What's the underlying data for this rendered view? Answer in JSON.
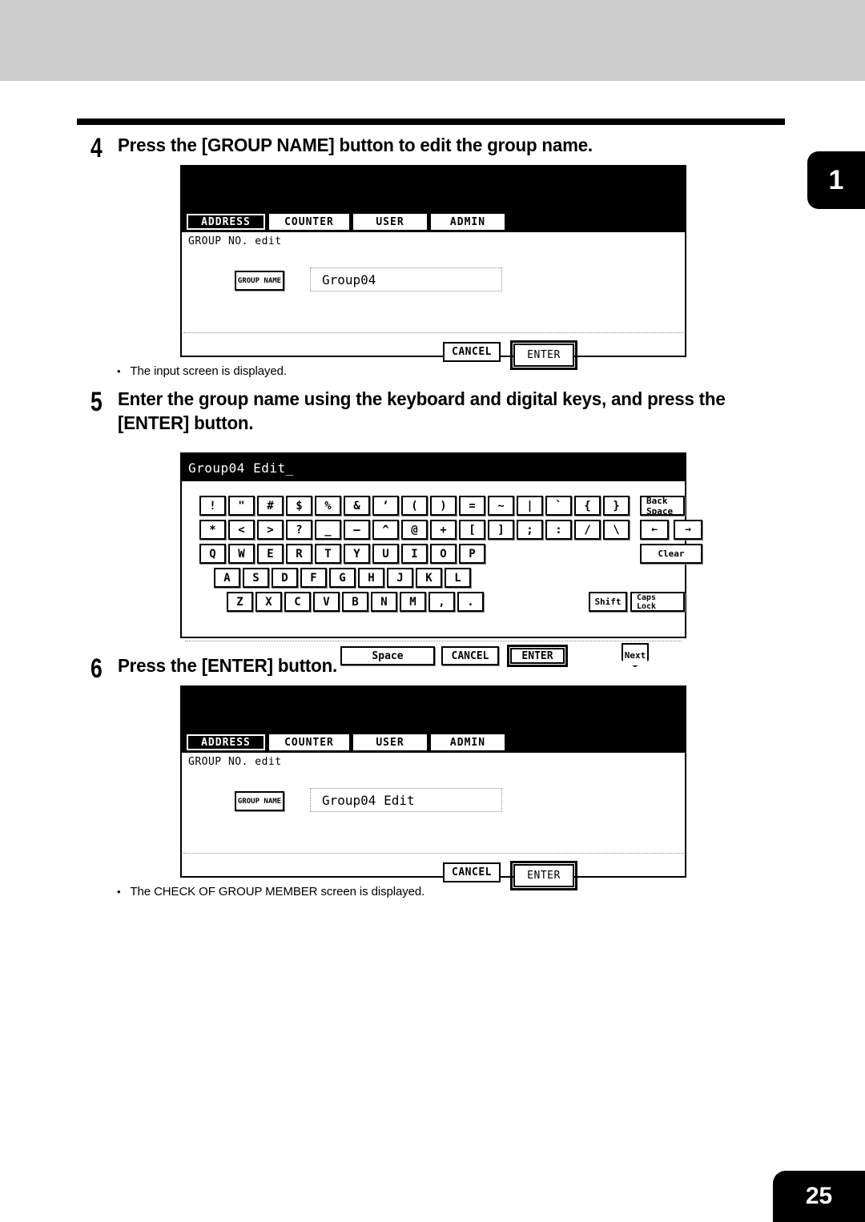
{
  "page": {
    "chapter_tab": "1",
    "page_number": "25"
  },
  "steps": [
    {
      "number": "4",
      "text": "Press the [GROUP NAME] button to edit the group name."
    },
    {
      "number": "5",
      "text": "Enter the group name using the keyboard and digital keys, and press the [ENTER] button."
    },
    {
      "number": "6",
      "text": "Press the [ENTER] button."
    }
  ],
  "notes": [
    {
      "bullet": "•",
      "text": "The input screen is displayed."
    },
    {
      "bullet": "•",
      "text": "The CHECK OF GROUP MEMBER screen is displayed."
    }
  ],
  "panel_a": {
    "tabs": [
      {
        "label": "ADDRESS",
        "active": true
      },
      {
        "label": "COUNTER",
        "active": false
      },
      {
        "label": "USER",
        "active": false
      },
      {
        "label": "ADMIN",
        "active": false
      }
    ],
    "screen_label": "GROUP NO. edit",
    "group_name_button": "GROUP NAME",
    "group_name_value": "Group04",
    "cancel_label": "CANCEL",
    "enter_label": "ENTER"
  },
  "panel_c": {
    "tabs": [
      {
        "label": "ADDRESS",
        "active": true
      },
      {
        "label": "COUNTER",
        "active": false
      },
      {
        "label": "USER",
        "active": false
      },
      {
        "label": "ADMIN",
        "active": false
      }
    ],
    "screen_label": "GROUP NO. edit",
    "group_name_button": "GROUP NAME",
    "group_name_value": "Group04 Edit",
    "cancel_label": "CANCEL",
    "enter_label": "ENTER"
  },
  "keyboard": {
    "title": "Group04 Edit_",
    "row1": [
      "!",
      "\"",
      "#",
      "$",
      "%",
      "&",
      "‘",
      "(",
      ")",
      "=",
      "~",
      "|",
      "`",
      "{",
      "}"
    ],
    "row1_extra": "Back Space",
    "row2": [
      "*",
      "<",
      ">",
      "?",
      "_",
      "—",
      "^",
      "@",
      "+",
      "[",
      "]",
      ";",
      ":",
      "/",
      "\\"
    ],
    "row2_extra_left": "←",
    "row2_extra_right": "→",
    "row3": [
      "Q",
      "W",
      "E",
      "R",
      "T",
      "Y",
      "U",
      "I",
      "O",
      "P"
    ],
    "row3_extra": "Clear",
    "row4": [
      "A",
      "S",
      "D",
      "F",
      "G",
      "H",
      "J",
      "K",
      "L"
    ],
    "row5": [
      "Z",
      "X",
      "C",
      "V",
      "B",
      "N",
      "M",
      ",",
      "."
    ],
    "row5_extra_shift": "Shift",
    "row5_extra_caps": "Caps Lock",
    "space_label": "Space",
    "cancel_label": "CANCEL",
    "enter_label": "ENTER",
    "next_label": "Next"
  }
}
